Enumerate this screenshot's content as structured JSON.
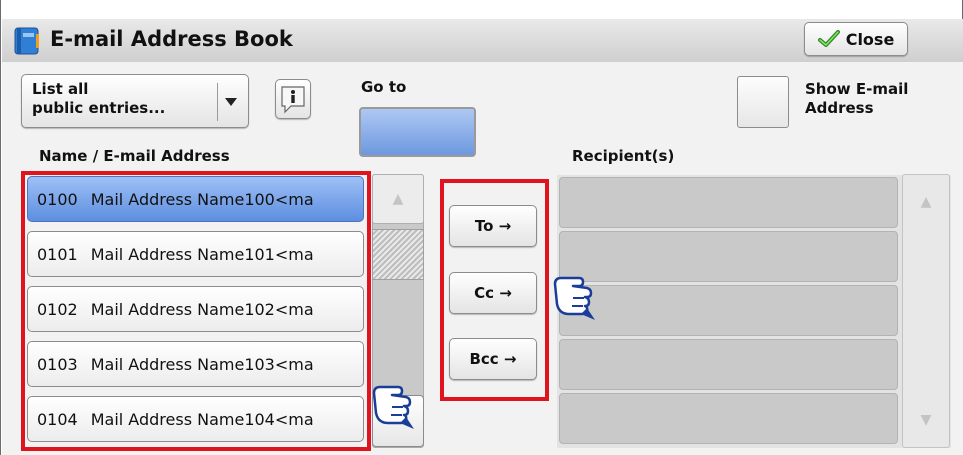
{
  "window": {
    "title": "E-mail Address Book",
    "close_label": "Close"
  },
  "filter": {
    "selected": "List all\npublic entries..."
  },
  "goto": {
    "label": "Go to"
  },
  "show_email": {
    "label": "Show E-mail\nAddress"
  },
  "list": {
    "header": "Name / E-mail Address",
    "entries": [
      {
        "num": "0100",
        "name": "Mail Address Name100<ma",
        "selected": true
      },
      {
        "num": "0101",
        "name": "Mail Address Name101<ma",
        "selected": false
      },
      {
        "num": "0102",
        "name": "Mail Address Name102<ma",
        "selected": false
      },
      {
        "num": "0103",
        "name": "Mail Address Name103<ma",
        "selected": false
      },
      {
        "num": "0104",
        "name": "Mail Address Name104<ma",
        "selected": false
      }
    ]
  },
  "actions": {
    "to": "To →",
    "cc": "Cc →",
    "bcc": "Bcc →"
  },
  "recipients": {
    "header": "Recipient(s)"
  },
  "icons": {
    "title": "address-book-icon",
    "close": "checkmark-icon",
    "info": "info-icon",
    "dropdown": "triangle-down-icon",
    "pointer": "pointing-hand-icon"
  },
  "colors": {
    "highlight": "#e0141e",
    "selected": "#7aa6ec"
  }
}
